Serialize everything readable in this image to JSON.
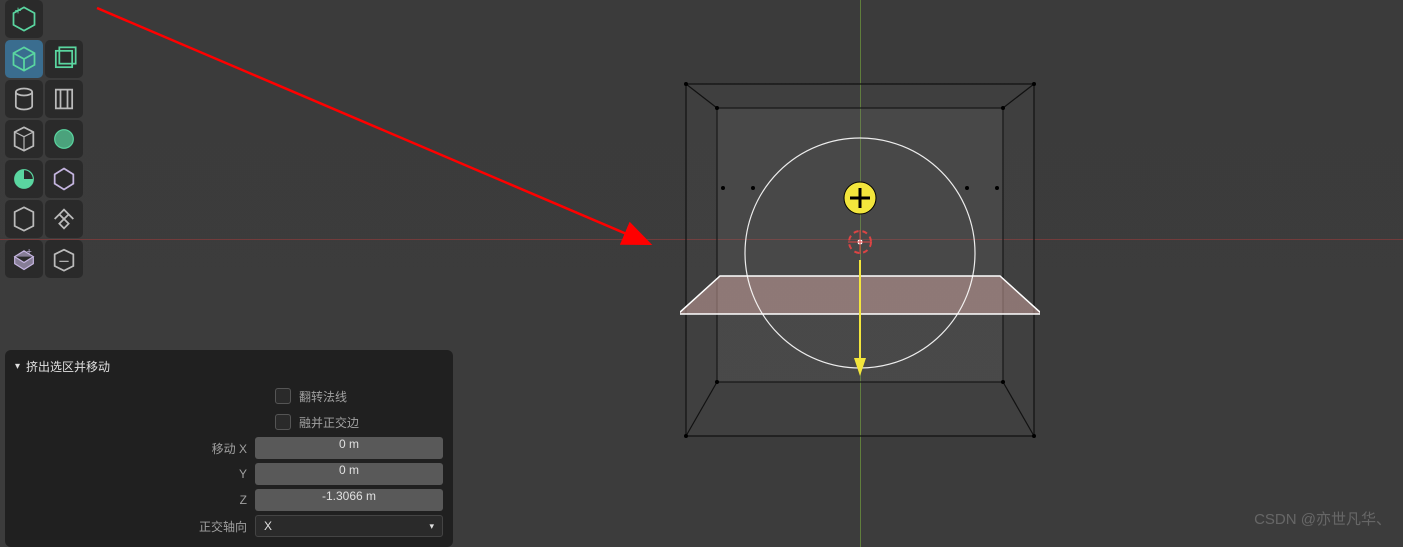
{
  "panel": {
    "title": "挤出选区并移动",
    "flip_normals_label": "翻转法线",
    "dissolve_ortho_label": "融并正交边",
    "move_x_label": "移动 X",
    "move_y_label": "Y",
    "move_z_label": "Z",
    "move_x_value": "0 m",
    "move_y_value": "0 m",
    "move_z_value": "-1.3066 m",
    "ortho_axis_label": "正交轴向",
    "ortho_axis_value": "X"
  },
  "tools": {
    "t0_0": "add-cube",
    "t1_0": "cube-tool",
    "t1_1": "cube-outline",
    "t2_0": "cylinder",
    "t2_1": "cylinder-alt",
    "t3_0": "wireframe",
    "t3_1": "sphere-shade",
    "t4_0": "pie",
    "t4_1": "polygon",
    "t5_0": "box",
    "t5_1": "snap",
    "t6_0": "extrude",
    "t6_1": "extrude-alt"
  },
  "watermark": "CSDN @亦世凡华、"
}
